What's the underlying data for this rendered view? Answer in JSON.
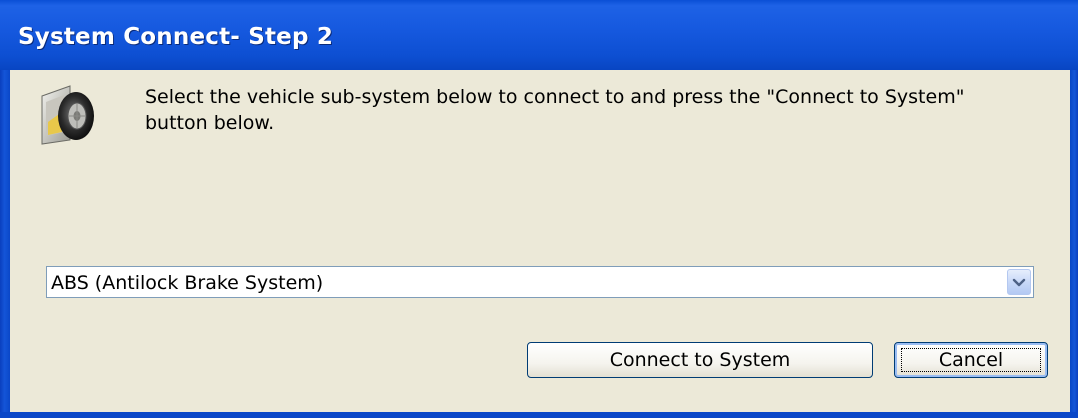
{
  "window": {
    "title": "System Connect- Step 2",
    "titlebar_color": "#1558DE",
    "background_color": "#ECE9D8"
  },
  "header": {
    "icon": "wheel-icon",
    "instructions": "Select the vehicle sub-system below to connect to and press the \"Connect to System\" button below."
  },
  "subsystem_select": {
    "selected_value": "ABS (Antilock Brake System)",
    "arrow_icon": "chevron-down-icon"
  },
  "buttons": {
    "connect_label": "Connect to System",
    "cancel_label": "Cancel"
  }
}
